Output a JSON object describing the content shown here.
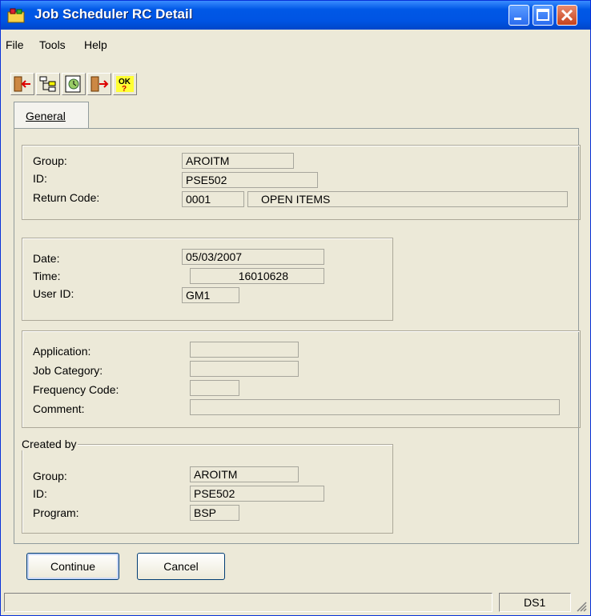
{
  "window": {
    "title": "Job Scheduler RC Detail"
  },
  "menu": {
    "items": [
      "File",
      "Tools",
      "Help"
    ]
  },
  "toolbar": {
    "icons": [
      "exit-icon",
      "tree-icon",
      "schedule-icon",
      "run-icon",
      "ok-help-icon"
    ]
  },
  "tabs": [
    {
      "label": "General"
    }
  ],
  "group1": {
    "group_label": "Group:",
    "group_value": "AROITM",
    "id_label": "ID:",
    "id_value": "PSE502",
    "return_code_label": "Return Code:",
    "return_code": "0001",
    "return_code_desc": "OPEN ITEMS"
  },
  "group2": {
    "date_label": "Date:",
    "date": "05/03/2007",
    "time_label": "Time:",
    "time": "16010628",
    "user_label": "User ID:",
    "user": "GM1"
  },
  "group3": {
    "application_label": "Application:",
    "application": "",
    "job_category_label": "Job Category:",
    "job_category": "",
    "frequency_label": "Frequency Code:",
    "frequency": "",
    "comment_label": "Comment:",
    "comment": ""
  },
  "created_by": {
    "legend": "Created by",
    "group_label": "Group:",
    "group_value": "AROITM",
    "id_label": "ID:",
    "id_value": "PSE502",
    "program_label": "Program:",
    "program": "BSP"
  },
  "buttons": {
    "continue": "Continue",
    "cancel": "Cancel"
  },
  "status": {
    "left": "",
    "right": "DS1"
  },
  "colors": {
    "titlebar": "#0054e3",
    "face": "#ece9d8",
    "close": "#c8421c"
  }
}
